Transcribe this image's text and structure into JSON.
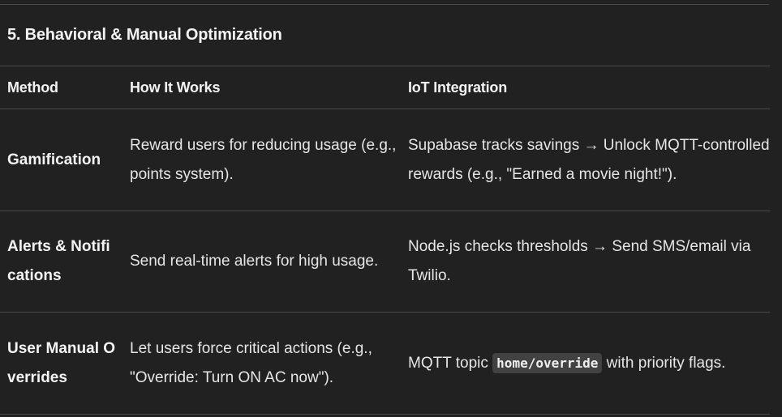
{
  "section": {
    "title": "5. Behavioral & Manual Optimization"
  },
  "table": {
    "headers": [
      "Method",
      "How It Works",
      "IoT Integration"
    ],
    "rows": [
      {
        "method": "Gamification",
        "how": "Reward users for reducing usage (e.g., points system).",
        "iot": "Supabase tracks savings → Unlock MQTT-controlled rewards (e.g., \"Earned a movie night!\")."
      },
      {
        "method": "Alerts & Notifications",
        "how": "Send real-time alerts for high usage.",
        "iot": "Node.js checks thresholds → Send SMS/email via Twilio."
      },
      {
        "method": "User Manual Overrides",
        "how": "Let users force critical actions (e.g., \"Override: Turn ON AC now\").",
        "iot_prefix": "MQTT topic ",
        "iot_code": "home/override",
        "iot_suffix": " with priority flags."
      }
    ]
  }
}
